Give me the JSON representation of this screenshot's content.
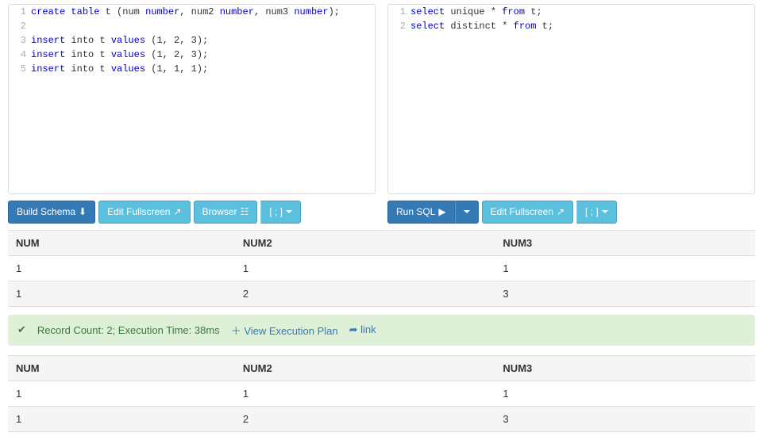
{
  "schema_editor": {
    "lines": [
      {
        "n": 1,
        "tokens": [
          {
            "t": "create",
            "kw": true
          },
          {
            "t": " "
          },
          {
            "t": "table",
            "kw": true
          },
          {
            "t": " t ("
          },
          {
            "t": "num",
            "kw": false
          },
          {
            "t": " "
          },
          {
            "t": "number",
            "kw": true
          },
          {
            "t": ", num2 "
          },
          {
            "t": "number",
            "kw": true
          },
          {
            "t": ", num3 "
          },
          {
            "t": "number",
            "kw": true
          },
          {
            "t": ");"
          }
        ]
      },
      {
        "n": 2,
        "tokens": []
      },
      {
        "n": 3,
        "tokens": [
          {
            "t": "insert",
            "kw": true
          },
          {
            "t": " into t "
          },
          {
            "t": "values",
            "kw": true
          },
          {
            "t": " (1, 2, 3);"
          }
        ]
      },
      {
        "n": 4,
        "tokens": [
          {
            "t": "insert",
            "kw": true
          },
          {
            "t": " into t "
          },
          {
            "t": "values",
            "kw": true
          },
          {
            "t": " (1, 2, 3);"
          }
        ]
      },
      {
        "n": 5,
        "tokens": [
          {
            "t": "insert",
            "kw": true
          },
          {
            "t": " into t "
          },
          {
            "t": "values",
            "kw": true
          },
          {
            "t": " (1, 1, 1);"
          }
        ]
      }
    ]
  },
  "query_editor": {
    "lines": [
      {
        "n": 1,
        "tokens": [
          {
            "t": "select",
            "kw": true
          },
          {
            "t": " unique * "
          },
          {
            "t": "from",
            "kw": true
          },
          {
            "t": " t;"
          }
        ]
      },
      {
        "n": 2,
        "tokens": [
          {
            "t": "select",
            "kw": true
          },
          {
            "t": " distinct * "
          },
          {
            "t": "from",
            "kw": true
          },
          {
            "t": " t;"
          }
        ]
      }
    ]
  },
  "left_toolbar": {
    "build_schema": "Build Schema",
    "edit_fullscreen": "Edit Fullscreen",
    "browser": "Browser",
    "terminator": "[ ; ]"
  },
  "right_toolbar": {
    "run_sql": "Run SQL",
    "edit_fullscreen": "Edit Fullscreen",
    "terminator": "[ ; ]"
  },
  "results1": {
    "headers": [
      "NUM",
      "NUM2",
      "NUM3"
    ],
    "rows": [
      [
        "1",
        "1",
        "1"
      ],
      [
        "1",
        "2",
        "3"
      ]
    ]
  },
  "status": {
    "summary": "Record Count: 2; Execution Time: 38ms",
    "view_plan": "View Execution Plan",
    "link": "link"
  },
  "results2": {
    "headers": [
      "NUM",
      "NUM2",
      "NUM3"
    ],
    "rows": [
      [
        "1",
        "1",
        "1"
      ],
      [
        "1",
        "2",
        "3"
      ]
    ]
  }
}
